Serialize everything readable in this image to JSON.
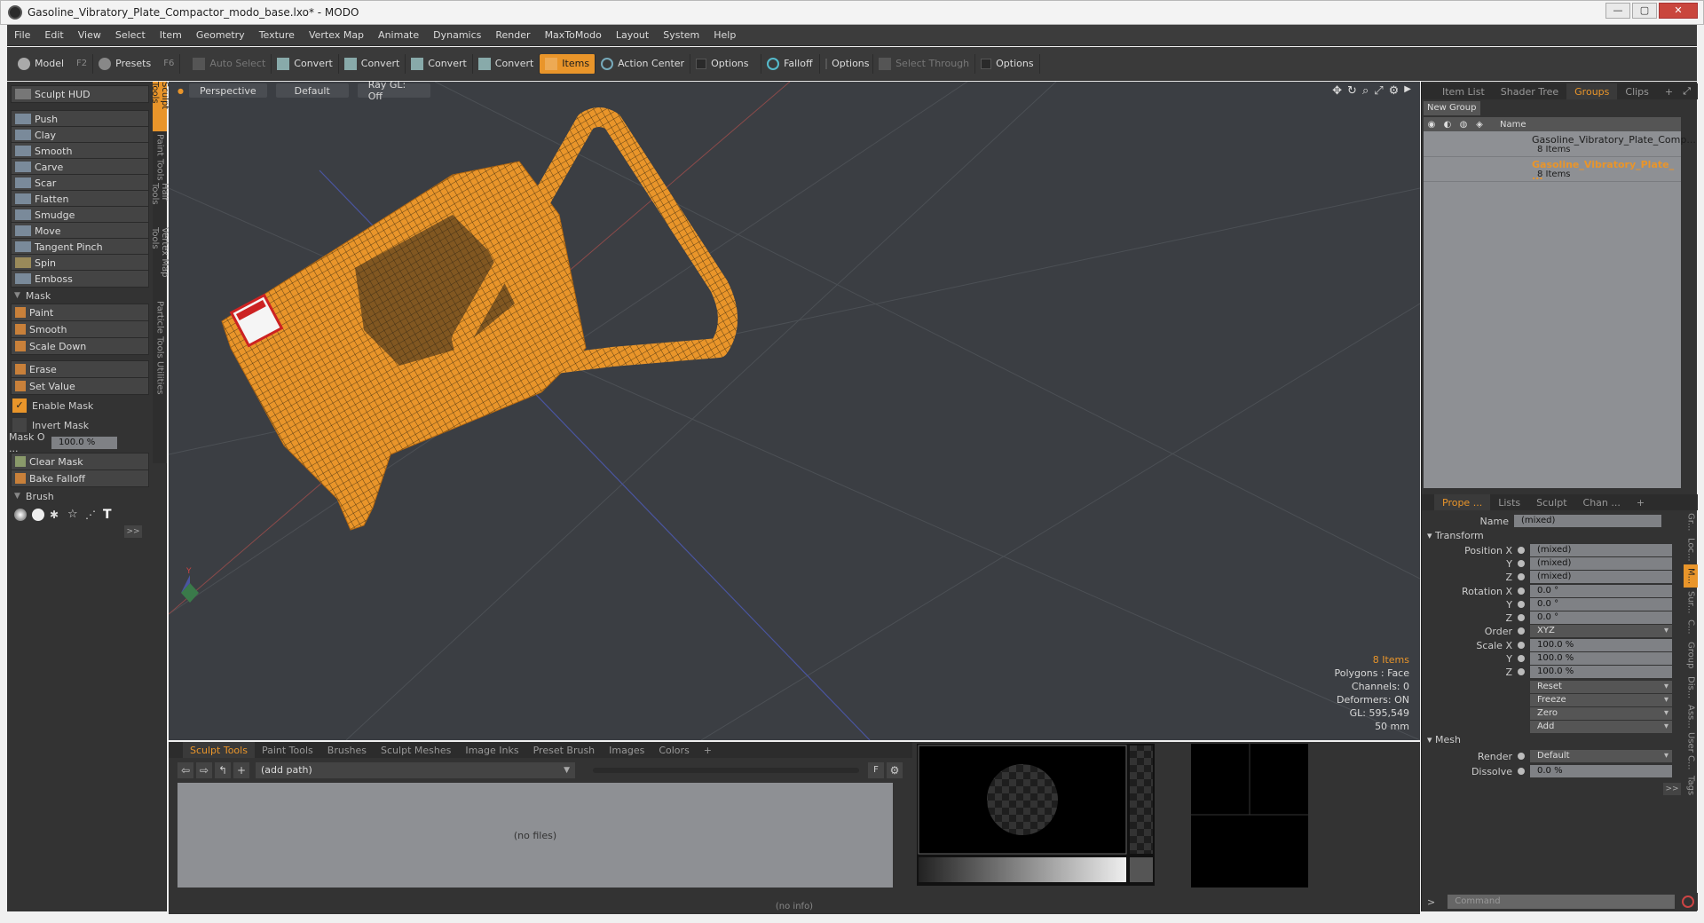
{
  "window": {
    "title": "Gasoline_Vibratory_Plate_Compactor_modo_base.lxo* - MODO",
    "buttons": [
      "—",
      "▢",
      "✕"
    ]
  },
  "menu": [
    "File",
    "Edit",
    "View",
    "Select",
    "Item",
    "Geometry",
    "Texture",
    "Vertex Map",
    "Animate",
    "Dynamics",
    "Render",
    "MaxToModo",
    "Layout",
    "System",
    "Help"
  ],
  "toolbar": {
    "model": "Model",
    "model_key": "F2",
    "presets": "Presets",
    "presets_key": "F6",
    "auto_select": "Auto Select",
    "convert1": "Convert",
    "convert2": "Convert",
    "convert3": "Convert",
    "convert4": "Convert",
    "items": "Items",
    "action_center": "Action Center",
    "options1": "Options",
    "falloff": "Falloff",
    "options2": "Options",
    "select_through": "Select Through",
    "options3": "Options"
  },
  "sculpt": {
    "hud": "Sculpt HUD",
    "tools": [
      "Push",
      "Clay",
      "Smooth",
      "Carve",
      "Scar",
      "Flatten",
      "Smudge",
      "Move",
      "Tangent Pinch",
      "Spin",
      "Emboss"
    ],
    "mask_section": "Mask",
    "mask_tools": [
      "Paint",
      "Smooth",
      "Scale Down"
    ],
    "erase": "Erase",
    "set_value": "Set Value",
    "enable_mask": "Enable Mask",
    "invert_mask": "Invert Mask",
    "mask_opacity_label": "Mask O ...",
    "mask_opacity_value": "100.0 %",
    "clear_mask": "Clear Mask",
    "bake_falloff": "Bake Falloff",
    "brush_section": "Brush",
    "more": ">>"
  },
  "left_vtabs": [
    "Sculpt Tools",
    "Paint Tools",
    "Hair Tools",
    "Vertex Map Tools",
    "Particle Tools",
    "Utilities"
  ],
  "viewport": {
    "tabs": [
      "Perspective",
      "Default",
      "Ray GL: Off"
    ],
    "info": {
      "items": "8 Items",
      "polygons": "Polygons : Face",
      "channels": "Channels: 0",
      "deformers": "Deformers: ON",
      "gl": "GL: 595,549",
      "scale": "50 mm"
    },
    "axis_label": "Y",
    "colors": {
      "background": "#3b3e43",
      "mesh": "#e9952a",
      "wire": "#3a2a10"
    }
  },
  "browser": {
    "tabs": [
      "Sculpt Tools",
      "Paint Tools",
      "Brushes",
      "Sculpt Meshes",
      "Image Inks",
      "Preset Brush",
      "Images",
      "Colors",
      "+"
    ],
    "path": "(add path)",
    "empty": "(no files)",
    "status": "(no info)"
  },
  "right_top": {
    "tabs": [
      "Item List",
      "Shader Tree",
      "Groups",
      "Clips",
      "+"
    ],
    "new_group": "New Group",
    "col_name": "Name",
    "groups": [
      {
        "name": "Gasoline_Vibratory_Plate_Comp...",
        "count": "8 Items"
      },
      {
        "name": "Gasoline_Vibratory_Plate_ ...",
        "count": "8 Items"
      }
    ]
  },
  "properties": {
    "tabs": [
      "Prope ...",
      "Lists",
      "Sculpt",
      "Chan ...",
      "+"
    ],
    "name_label": "Name",
    "name_value": "(mixed)",
    "transform": "Transform",
    "pos_x_label": "Position X",
    "pos_x": "(mixed)",
    "pos_y_label": "Y",
    "pos_y": "(mixed)",
    "pos_z_label": "Z",
    "pos_z": "(mixed)",
    "rot_x_label": "Rotation X",
    "rot_x": "0.0 °",
    "rot_y_label": "Y",
    "rot_y": "0.0 °",
    "rot_z_label": "Z",
    "rot_z": "0.0 °",
    "order_label": "Order",
    "order": "XYZ",
    "scale_x_label": "Scale X",
    "scale_x": "100.0 %",
    "scale_y_label": "Y",
    "scale_y": "100.0 %",
    "scale_z_label": "Z",
    "scale_z": "100.0 %",
    "reset": "Reset",
    "freeze": "Freeze",
    "zero": "Zero",
    "add": "Add",
    "mesh": "Mesh",
    "render_label": "Render",
    "render": "Default",
    "dissolve_label": "Dissolve",
    "dissolve": "0.0 %",
    "more": ">>"
  },
  "right_vtabs": [
    "Gr...",
    "Loc...",
    "M...",
    "Sur...",
    "C...",
    "Group",
    "Dis...",
    "Ass...",
    "User C...",
    "Tags"
  ],
  "command": {
    "prompt": ">",
    "placeholder": "Command"
  }
}
